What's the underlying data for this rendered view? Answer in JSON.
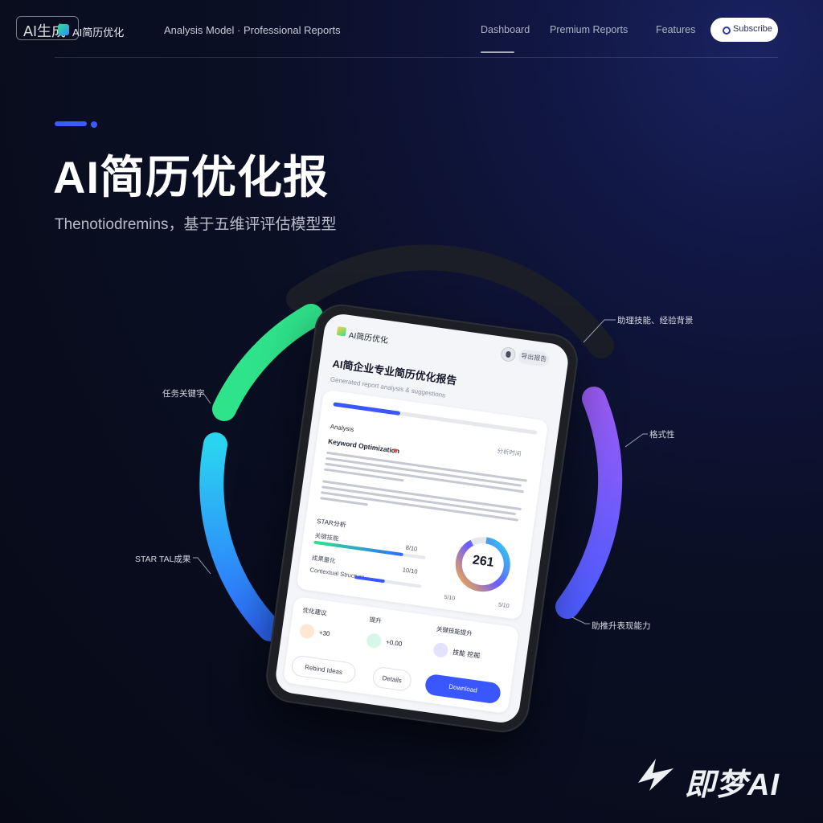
{
  "header": {
    "badge": "AI生成",
    "brand": "AI简历优化",
    "tagline": "Analysis Model · Professional Reports",
    "nav": [
      "Dashboard",
      "Premium Reports",
      "Features"
    ],
    "cta": "Subscribe"
  },
  "hero": {
    "title": "AI简历优化报",
    "subtitle": "Thenotiodremins，基于五维评评估模型型"
  },
  "callouts": {
    "top_right": "助理技能、经验背景",
    "left_top": "任务关键字",
    "right_mid": "格式性",
    "left_bottom": "STAR TAL成果",
    "bottom_right": "助推升表现能力"
  },
  "device": {
    "app_name": "AI简历优化",
    "header_chip": "导出报告",
    "report_title": "AI简企业专业简历优化报告",
    "report_subtitle": "Generated report analysis & suggestions",
    "progress": 0.33,
    "section_label": "Analysis",
    "section_meta": "分析时间",
    "item_head": "Keyword Optimization",
    "score_label": "STAR分析",
    "metrics": [
      {
        "name": "关键技能",
        "value": "8/10",
        "level": 0.8
      },
      {
        "name": "成果量化",
        "value": "10/10",
        "level": 0.5
      },
      {
        "name": "Contextual Structure",
        "value": "",
        "level": 0.45
      }
    ],
    "score": "261",
    "score_foot_left": "5/10",
    "score_foot_right": "5/10",
    "bottom_heads": [
      "优化建议",
      "提升",
      "关键技能提升"
    ],
    "bottom_stats": [
      "+30",
      "+0.00",
      "技能 挖掘"
    ],
    "buttons": {
      "left": "Rebind Ideas",
      "mid": "Details",
      "primary": "Download"
    }
  },
  "watermark": "即梦AI",
  "colors": {
    "accent": "#3b5bff",
    "ring_green": "#2fe38a",
    "ring_cyan": "#2ad4f0",
    "ring_blue": "#2f6bff",
    "ring_purple": "#8b5cf6"
  }
}
